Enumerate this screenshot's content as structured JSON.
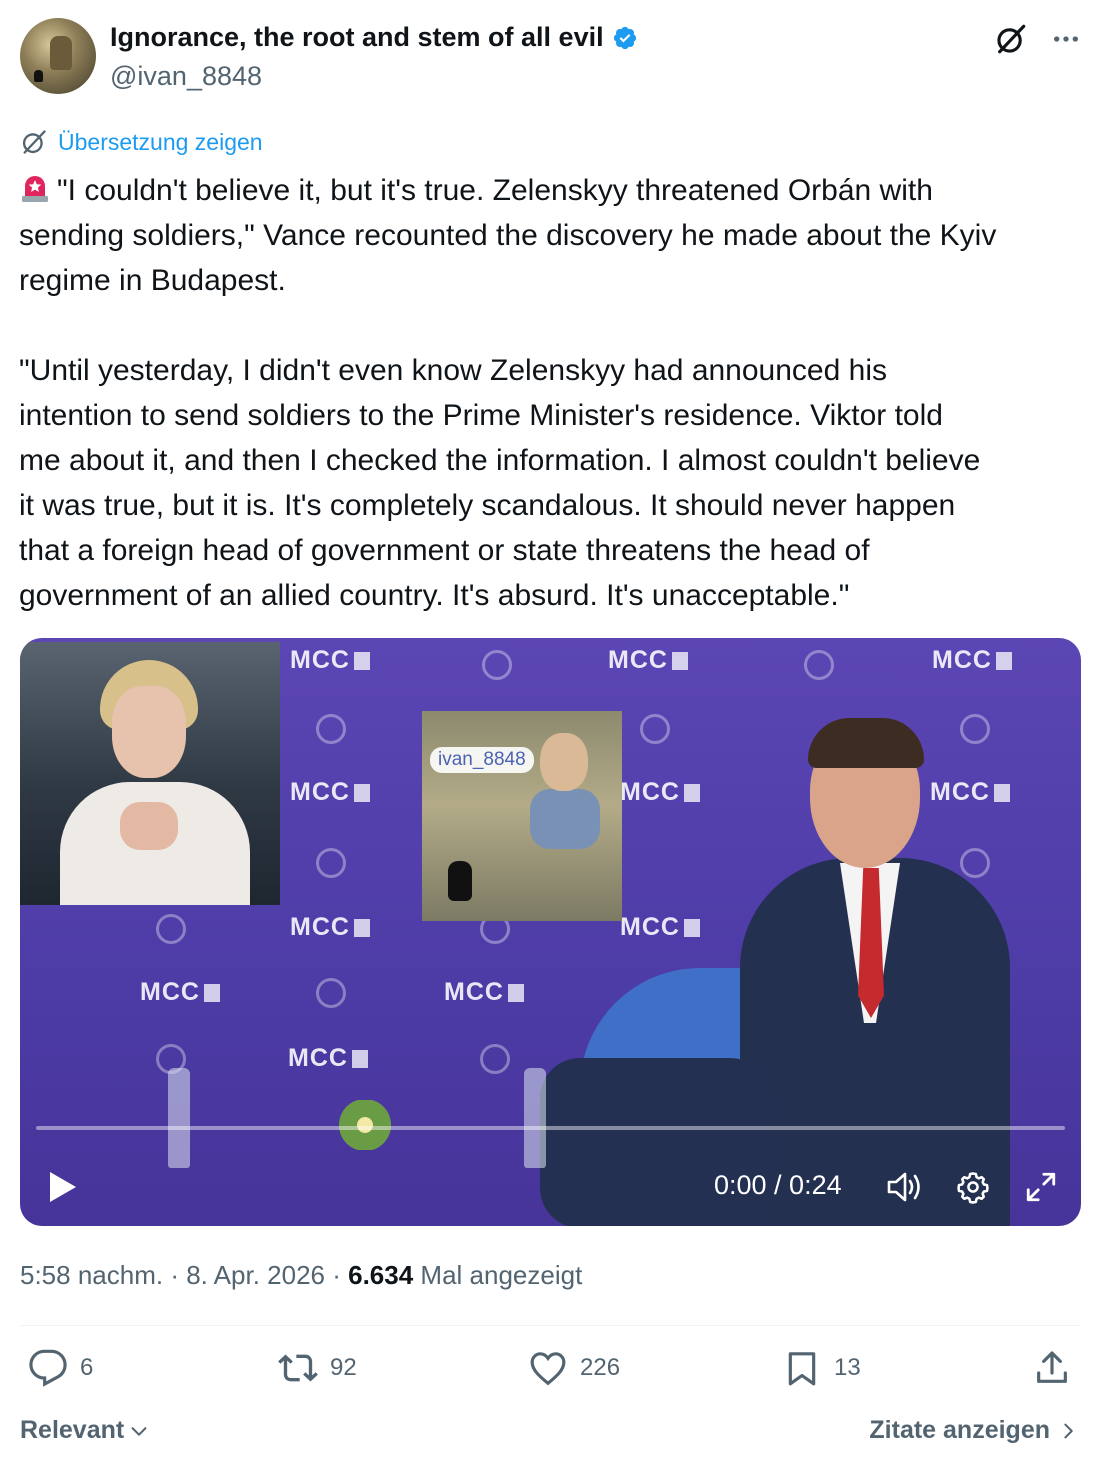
{
  "author": {
    "display_name": "Ignorance, the root and stem of all evil",
    "handle": "@ivan_8848",
    "verified": true,
    "badge_color": "#1d9bf0"
  },
  "translate_link": "Übersetzung zeigen",
  "tweet": {
    "emoji": "rotating-light-emoji",
    "lines": [
      "\"I couldn't believe it, but it's true. Zelenskyy threatened Orbán with",
      "sending soldiers,\" Vance recounted the discovery he made about the Kyiv",
      "regime in Budapest.",
      "",
      "\"Until yesterday, I didn't even know Zelenskyy had announced his",
      "intention to send soldiers to the Prime Minister's residence. Viktor told",
      "me about it, and then I checked the information. I almost couldn't believe",
      "it was true, but it is. It's completely scandalous. It should never happen",
      "that a foreign head of government or state threatens the head of",
      "government of an allied country. It's absurd. It's unacceptable.\""
    ]
  },
  "video": {
    "backdrop_logo": "MCC",
    "watermark": "ivan_8848",
    "time": "0:00 / 0:24",
    "progress": 0,
    "icons": [
      "play-icon",
      "volume-icon",
      "settings-icon",
      "fullscreen-icon"
    ]
  },
  "meta": {
    "time": "5:58 nachm.",
    "date": "8. Apr. 2026",
    "views_count": "6.634",
    "views_label": "Mal angezeigt"
  },
  "actions": {
    "replies": "6",
    "reposts": "92",
    "likes": "226",
    "bookmarks": "13"
  },
  "footer": {
    "sort_label": "Relevant",
    "quotes_label": "Zitate anzeigen"
  },
  "colors": {
    "accent": "#1d9bf0",
    "text_primary": "#0f1419",
    "text_secondary": "#536471",
    "siren": "#e0245e"
  }
}
